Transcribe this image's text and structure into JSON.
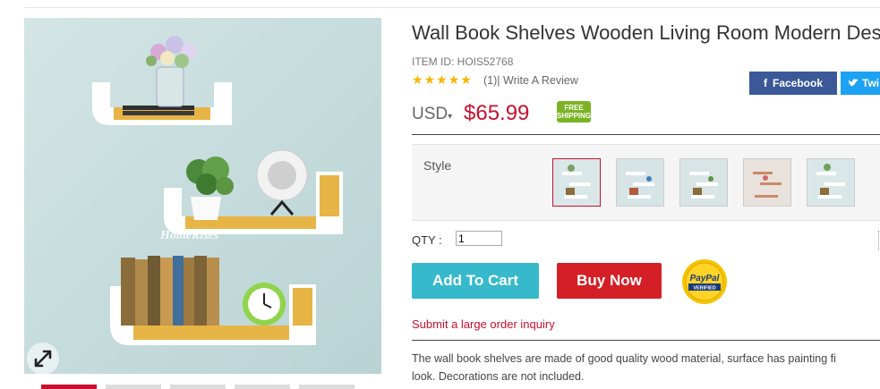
{
  "product": {
    "title": "Wall Book Shelves Wooden Living Room Modern Des",
    "item_id": "ITEM ID: HOIS52768",
    "review_count": "(1)|",
    "write_review": "Write A Review",
    "rating": 5,
    "currency": "USD",
    "price": "$65.99",
    "free_shipping": [
      "FREE",
      "SHIPPING"
    ],
    "watermark": "HomeRises"
  },
  "share": {
    "facebook": "Facebook",
    "twitter": "Twi"
  },
  "style": {
    "label": "Style",
    "selected_index": 0,
    "count": 5
  },
  "qty": {
    "label": "QTY :",
    "value": "1"
  },
  "buttons": {
    "add_to_cart": "Add To Cart",
    "buy_now": "Buy Now"
  },
  "paypal": {
    "line1": "PayPal",
    "line2": "VERIFIED"
  },
  "inquiry": "Submit a large order inquiry",
  "description": [
    "The wall book shelves are made of good quality wood material, surface has painting fi",
    "look. Decorations are not included."
  ],
  "colors": {
    "price": "#c8102e",
    "cart": "#36b9ca",
    "buy": "#d51f26",
    "facebook": "#3b5998",
    "twitter": "#1da1f2",
    "free_shipping": "#7cb324"
  }
}
